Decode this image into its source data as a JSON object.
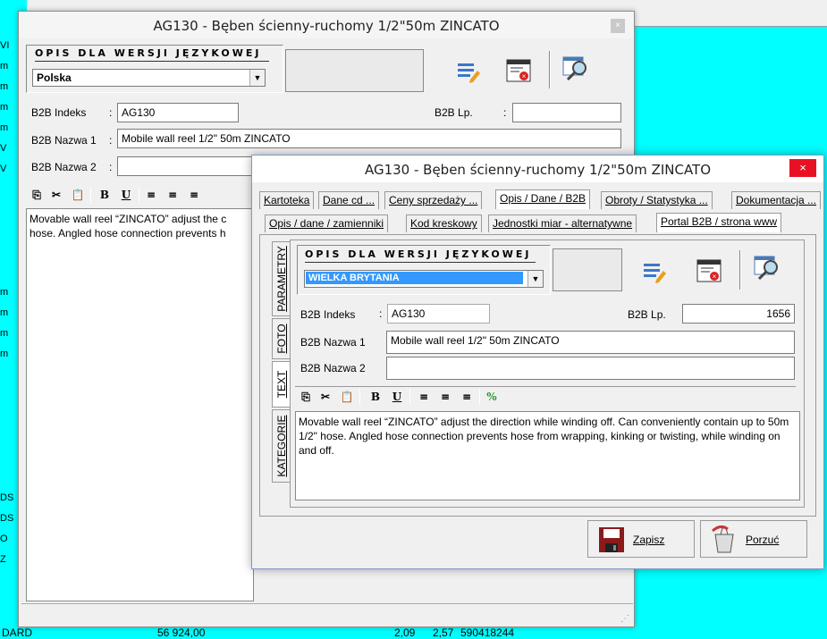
{
  "background": {
    "left_cells": [
      "VI",
      "m",
      "m",
      "m",
      "m",
      "V",
      "V",
      "",
      "",
      "",
      "",
      "",
      "m",
      "m",
      "m",
      "m",
      "",
      "",
      "",
      "",
      "",
      "",
      "DS",
      "DS",
      "O",
      "Z"
    ],
    "bottom_row": [
      "DARD",
      "56 924,00",
      "2,09",
      "2,57",
      "590418244"
    ]
  },
  "win1": {
    "title": "AG130 - Bęben ścienny-ruchomy  1/2\"50m ZINCATO",
    "close": "×",
    "lang_title": "OPIS DLA WERSJI JĘZYKOWEJ",
    "lang_value": "Polska",
    "b2b_index_label": "B2B Indeks",
    "b2b_index_value": "AG130",
    "b2b_lp_label": "B2B Lp.",
    "b2b_lp_value": "",
    "nazwa1_label": "B2B Nazwa 1",
    "nazwa1_value": "Mobile wall reel 1/2\" 50m ZINCATO",
    "nazwa2_label": "B2B Nazwa 2",
    "nazwa2_value": "",
    "text": "Movable wall reel “ZINCATO” adjust the c\nhose. Angled hose connection prevents h"
  },
  "win2": {
    "title": "AG130 - Bęben ścienny-ruchomy  1/2\"50m ZINCATO",
    "close": "×",
    "tabs_row1": [
      "Kartoteka",
      "Dane cd ...",
      "Ceny sprzedaży ...",
      "Opis / Dane / B2B",
      "Obroty / Statystyka ...",
      "Dokumentacja ..."
    ],
    "tabs_row2": [
      "Opis / dane / zamienniki",
      "Kod kreskowy",
      "Jednostki miar - alternatywne",
      "Portal B2B / strona www"
    ],
    "vtabs": [
      "PARAMETRY",
      "FOTO",
      "TEXT",
      "KATEGORIE"
    ],
    "lang_title": "OPIS DLA WERSJI JĘZYKOWEJ",
    "lang_value": "WIELKA BRYTANIA",
    "b2b_index_label": "B2B Indeks",
    "b2b_index_value": "AG130",
    "b2b_lp_label": "B2B Lp.",
    "b2b_lp_value": "1656",
    "nazwa1_label": "B2B Nazwa 1",
    "nazwa1_value": "Mobile wall reel 1/2\" 50m ZINCATO",
    "nazwa2_label": "B2B Nazwa 2",
    "nazwa2_value": "",
    "text": "Movable wall reel “ZINCATO” adjust the direction while winding off. Can conveniently contain up to 50m 1/2\" hose. Angled hose connection prevents hose from wrapping, kinking or twisting, while winding on and off.",
    "save_label": "Zapisz",
    "discard_label": "Porzuć"
  },
  "toolbar": {
    "bold": "B",
    "underline": "U"
  },
  "colors": {
    "background": "#00ffff",
    "selection": "#3399ff",
    "close_red": "#e81123"
  }
}
